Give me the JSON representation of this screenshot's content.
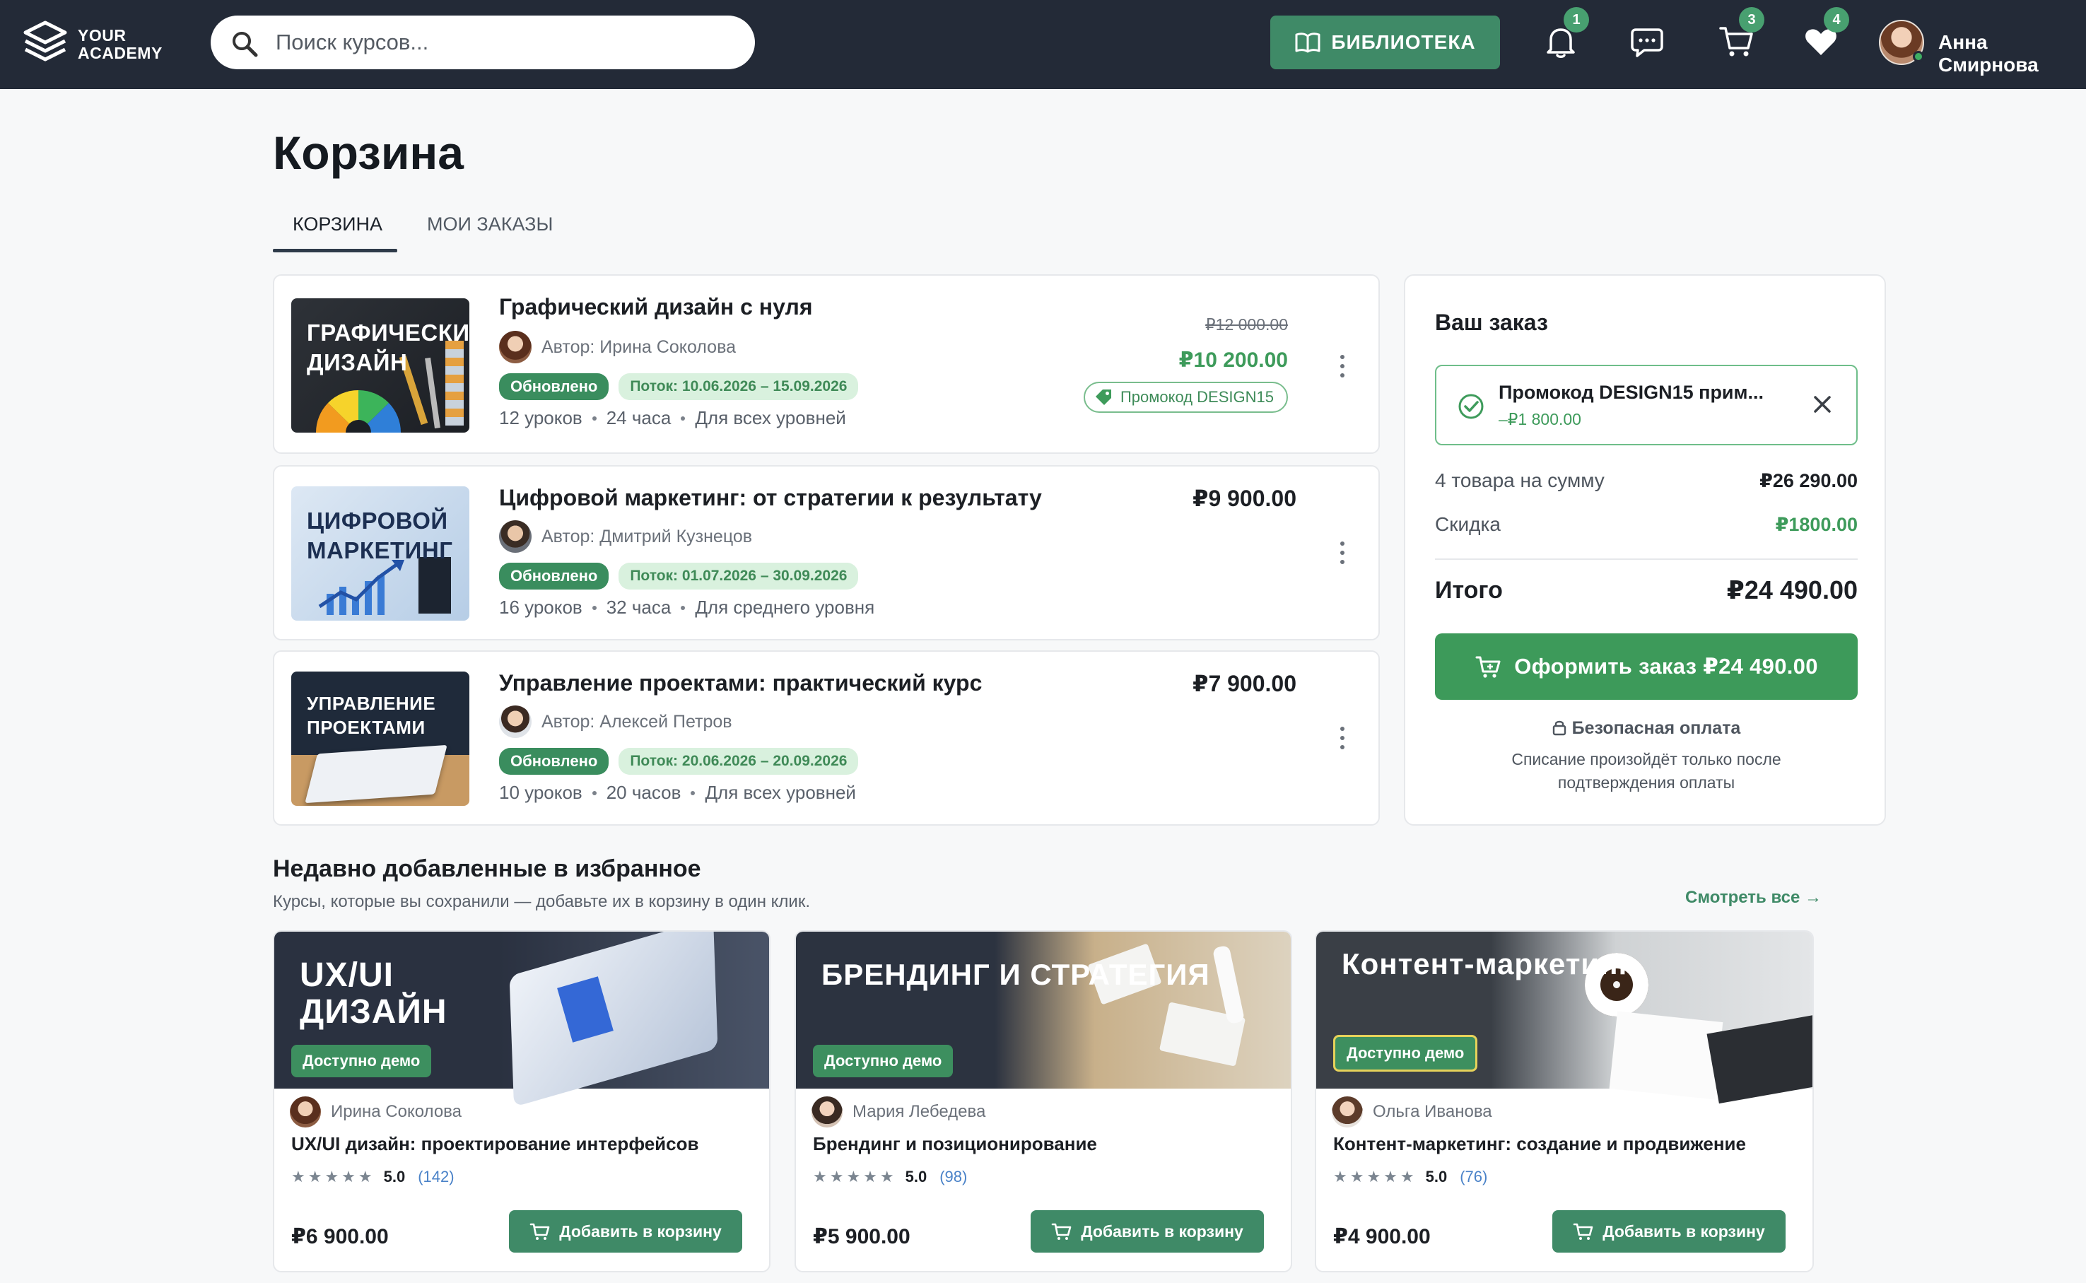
{
  "header": {
    "logo_line1": "YOUR",
    "logo_line2": "ACADEMY",
    "search_placeholder": "Поиск курсов...",
    "library_label": "БИБЛИОТЕКА",
    "notifications_count": "1",
    "cart_count": "3",
    "favorites_count": "4",
    "user_name": "Анна Смирнова"
  },
  "page": {
    "title": "Корзина",
    "tabs": [
      {
        "label": "КОРЗИНА",
        "active": true
      },
      {
        "label": "МОИ ЗАКАЗЫ",
        "active": false
      }
    ]
  },
  "cart_items": [
    {
      "thumb_text": "ГРАФИЧЕСКИЙ ДИЗАЙН",
      "title": "Графический дизайн с нуля",
      "author": "Автор: Ирина Соколова",
      "tag_updated": "Обновлено",
      "tag_flow": "Поток: 10.06.2026 – 15.09.2026",
      "lessons": "12 уроков",
      "hours": "24 часа",
      "level": "Для всех уровней",
      "price_old": "₽12 000.00",
      "price_new": "₽10 200.00",
      "promo": "Промокод DESIGN15"
    },
    {
      "thumb_text": "ЦИФРОВОЙ МАРКЕТИНГ",
      "title": "Цифровой маркетинг: от стратегии к результату",
      "author": "Автор: Дмитрий Кузнецов",
      "tag_updated": "Обновлено",
      "tag_flow": "Поток: 01.07.2026 – 30.09.2026",
      "lessons": "16 уроков",
      "hours": "32 часа",
      "level": "Для среднего уровня",
      "price": "₽9 900.00"
    },
    {
      "thumb_text": "УПРАВЛЕНИЕ ПРОЕКТАМИ",
      "title": "Управление проектами: практический курс",
      "author": "Автор: Алексей Петров",
      "tag_updated": "Обновлено",
      "tag_flow": "Поток: 20.06.2026 – 20.09.2026",
      "lessons": "10 уроков",
      "hours": "20 часов",
      "level": "Для всех уровней",
      "price": "₽7 900.00"
    }
  ],
  "order": {
    "title": "Ваш заказ",
    "promo_title": "Промокод DESIGN15 прим...",
    "promo_discount": "–₽1 800.00",
    "items_label": "4 товара на сумму",
    "items_value": "₽26 290.00",
    "discount_label": "Скидка",
    "discount_value": "₽1800.00",
    "total_label": "Итого",
    "total_value": "₽24 490.00",
    "checkout_label": "Оформить заказ ₽24 490.00",
    "secure_label": "Безопасная оплата",
    "secure_note": "Списание произойдёт только после подтверждения оплаты"
  },
  "favorites": {
    "title": "Недавно добавленные в избранное",
    "subtitle": "Курсы, которые вы сохранили — добавьте их в корзину в один клик.",
    "see_all": "Смотреть все →",
    "items": [
      {
        "image_text": "UX/UI ДИЗАЙН",
        "demo": "Доступно демо",
        "author": "Ирина Соколова",
        "name": "UX/UI дизайн: проектирование интерфейсов",
        "rating": "5.0",
        "reviews": "(142)",
        "price": "₽6 900.00",
        "button": "Добавить в корзину"
      },
      {
        "image_text": "БРЕНДИНГ И СТРАТЕГИЯ",
        "demo": "Доступно демо",
        "author": "Мария Лебедева",
        "name": "Брендинг и позиционирование",
        "rating": "5.0",
        "reviews": "(98)",
        "price": "₽5 900.00",
        "button": "Добавить в корзину"
      },
      {
        "image_text": "Контент-маркетинг",
        "demo": "Доступно демо",
        "author": "Ольга Иванова",
        "name": "Контент-маркетинг: создание и продвижение",
        "rating": "5.0",
        "reviews": "(76)",
        "price": "₽4 900.00",
        "button": "Добавить в корзину"
      }
    ]
  },
  "colors": {
    "header_bg": "#232a37",
    "accent_green": "#3d9a5a",
    "price_green": "#3e9b5b",
    "badge_green": "#48a070"
  }
}
